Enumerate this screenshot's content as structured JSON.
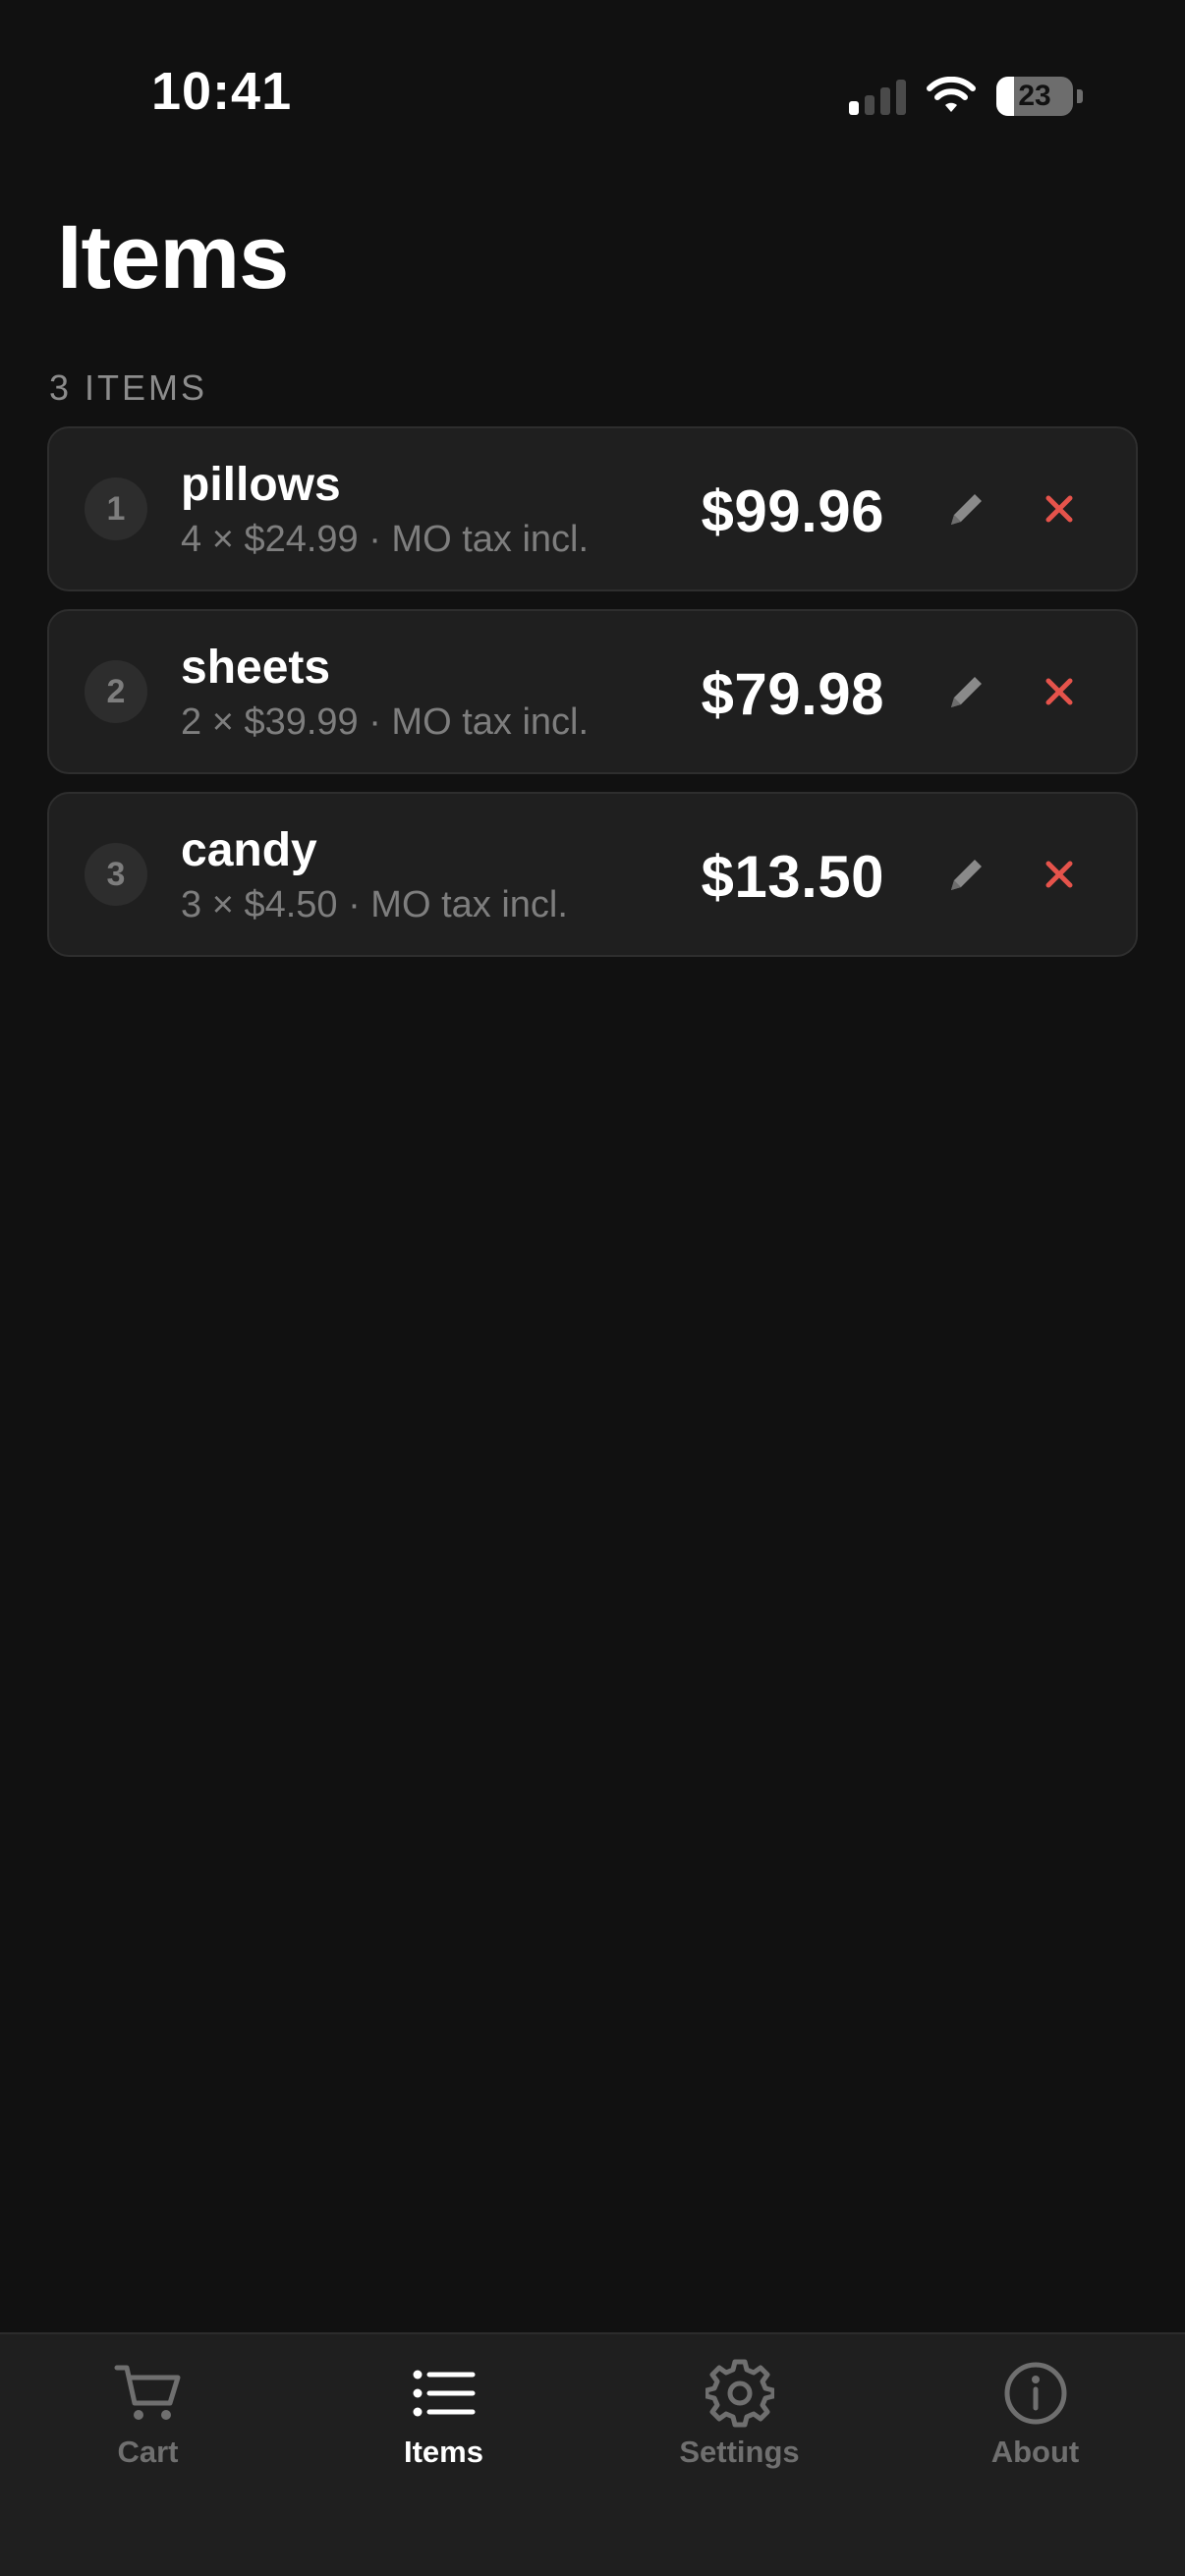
{
  "status_bar": {
    "time": "10:41",
    "battery": "23",
    "signal_icon": "cellular-signal-icon",
    "wifi_icon": "wifi-icon"
  },
  "header": {
    "title": "Items",
    "section": "3 ITEMS"
  },
  "items": [
    {
      "index": "1",
      "name": "pillows",
      "detail": "4 × $24.99 · MO tax incl.",
      "price": "$99.96"
    },
    {
      "index": "2",
      "name": "sheets",
      "detail": "2 × $39.99 · MO tax incl.",
      "price": "$79.98"
    },
    {
      "index": "3",
      "name": "candy",
      "detail": "3 × $4.50 · MO tax incl.",
      "price": "$13.50"
    }
  ],
  "tabs": [
    {
      "label": "Cart",
      "icon": "cart-icon",
      "active": false
    },
    {
      "label": "Items",
      "icon": "list-icon",
      "active": true
    },
    {
      "label": "Settings",
      "icon": "gear-icon",
      "active": false
    },
    {
      "label": "About",
      "icon": "info-icon",
      "active": false
    }
  ],
  "colors": {
    "background": "#111111",
    "card": "#1f1f1f",
    "delete_accent": "#e5534b",
    "muted_text": "#7e7e7e"
  }
}
